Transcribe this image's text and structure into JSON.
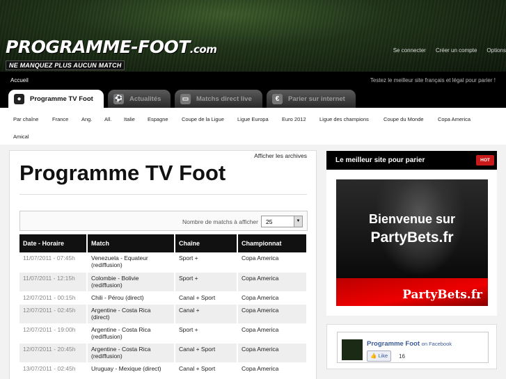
{
  "header": {
    "logo_main": "PROGRAMME-FOOT",
    "logo_com": ".com",
    "logo_tagline": "NE MANQUEZ PLUS AUCUN MATCH",
    "links": [
      "Se connecter",
      "Créer un compte",
      "Options"
    ]
  },
  "navbar": {
    "home": "Accueil",
    "slogan": "Testez le meilleur site français et légal pour parier !"
  },
  "tabs": [
    {
      "label": "Programme TV Foot",
      "icon": "soccer-ball-icon",
      "active": true
    },
    {
      "label": "Actualités",
      "icon": "player-icon",
      "active": false
    },
    {
      "label": "Matchs direct live",
      "icon": "tv-icon",
      "active": false
    },
    {
      "label": "Parier sur internet",
      "icon": "euro-icon",
      "active": false
    }
  ],
  "subnav": [
    "Par chaîne",
    "France",
    "Ang.",
    "All.",
    "Italie",
    "Espagne",
    "Coupe de la Ligue",
    "Ligue Europa",
    "Euro 2012",
    "Ligue des champions",
    "Coupe du Monde",
    "Copa America",
    "Amical"
  ],
  "main": {
    "archives": "Afficher les archives",
    "title": "Programme TV Foot",
    "count_label": "Nombre de matchs à afficher",
    "count_value": "25",
    "columns": [
      "Date - Horaire",
      "Match",
      "Chaîne",
      "Championnat"
    ],
    "rows": [
      {
        "date": "11/07/2011 - 07:45h",
        "match": "Venezuela - Equateur",
        "note": "(rediffusion)",
        "channel": "Sport +",
        "league": "Copa America"
      },
      {
        "date": "11/07/2011 - 12:15h",
        "match": "Colombie - Bolivie",
        "note": "(rediffusion)",
        "channel": "Sport +",
        "league": "Copa America"
      },
      {
        "date": "12/07/2011 - 00:15h",
        "match": "Chili - Pérou (direct)",
        "note": "",
        "channel": "Canal + Sport",
        "league": "Copa America"
      },
      {
        "date": "12/07/2011 - 02:45h",
        "match": "Argentine - Costa Rica",
        "note": "(direct)",
        "channel": "Canal +",
        "league": "Copa America"
      },
      {
        "date": "12/07/2011 - 19:00h",
        "match": "Argentine - Costa Rica",
        "note": "(rediffusion)",
        "channel": "Sport +",
        "league": "Copa America"
      },
      {
        "date": "12/07/2011 - 20:45h",
        "match": "Argentine - Costa Rica",
        "note": "(rediffusion)",
        "channel": "Canal + Sport",
        "league": "Copa America"
      },
      {
        "date": "13/07/2011 - 02:45h",
        "match": "Uruguay - Mexique (direct)",
        "note": "",
        "channel": "Canal + Sport",
        "league": "Copa America"
      }
    ]
  },
  "sidebar": {
    "title": "Le meilleur site pour parier",
    "badge": "HOT",
    "banner_line1": "Bienvenue sur",
    "banner_line2": "PartyBets.fr",
    "banner_brand": "PartyBets.fr",
    "fb_name": "Programme Foot",
    "fb_on": "on Facebook",
    "fb_like": "Like",
    "fb_count": "16"
  }
}
